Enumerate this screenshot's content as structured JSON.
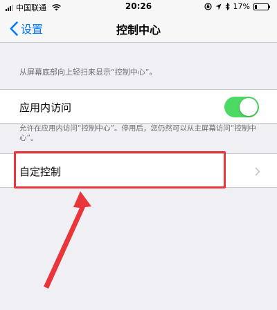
{
  "status_bar": {
    "carrier": "中国联通",
    "time": "20:26",
    "battery_percent": "17%",
    "battery_level": 0.17,
    "icons": [
      "signal-icon",
      "wifi-icon",
      "orientation-lock-icon",
      "location-icon",
      "bluetooth-icon",
      "battery-icon"
    ]
  },
  "nav": {
    "back_label": "设置",
    "title": "控制中心"
  },
  "description": "从屏幕底部向上轻扫来显示“控制中心”。",
  "in_app_access": {
    "label": "应用内访问",
    "enabled": true,
    "footnote": "允许在应用内访问“控制中心”。停用后，您仍然可以从主屏幕访问“控制中心”。"
  },
  "customize": {
    "label": "自定控制"
  },
  "colors": {
    "accent": "#007aff",
    "toggle_on": "#4cd964",
    "annotation": "#e8363a",
    "background": "#efeff4"
  }
}
